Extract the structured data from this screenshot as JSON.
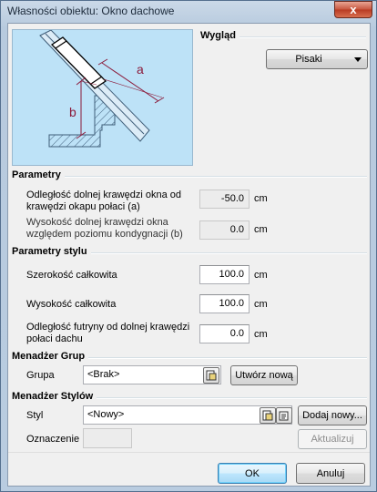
{
  "window": {
    "title": "Własności obiektu: Okno dachowe",
    "close_glyph": "x"
  },
  "appearance": {
    "title": "Wygląd",
    "pens_button": "Pisaki"
  },
  "diagram": {
    "label_a": "a",
    "label_b": "b"
  },
  "parameters": {
    "title": "Parametry",
    "rows": [
      {
        "label": "Odległość dolnej krawędzi okna od krawędzi okapu połaci (a)",
        "value": "-50.0",
        "unit": "cm"
      },
      {
        "label": "Wysokość dolnej krawędzi okna względem poziomu kondygnacji (b)",
        "value": "0.0",
        "unit": "cm"
      }
    ]
  },
  "style_parameters": {
    "title": "Parametry stylu",
    "rows": [
      {
        "label": "Szerokość całkowita",
        "value": "100.0",
        "unit": "cm"
      },
      {
        "label": "Wysokość całkowita",
        "value": "100.0",
        "unit": "cm"
      },
      {
        "label": "Odległość futryny od dolnej krawędzi połaci dachu",
        "value": "0.0",
        "unit": "cm"
      }
    ]
  },
  "group_manager": {
    "title": "Menadżer Grup",
    "group_label": "Grupa",
    "group_value": "<Brak>",
    "create_button": "Utwórz nową"
  },
  "style_manager": {
    "title": "Menadżer Stylów",
    "style_label": "Styl",
    "style_value": "<Nowy>",
    "add_button": "Dodaj nowy...",
    "marking_label": "Oznaczenie",
    "marking_value": "",
    "update_button": "Aktualizuj"
  },
  "footer": {
    "ok_button": "OK",
    "cancel_button": "Anuluj"
  },
  "colors": {
    "preview_bg": "#bde2f7",
    "dimension_line": "#8b1a3a"
  }
}
